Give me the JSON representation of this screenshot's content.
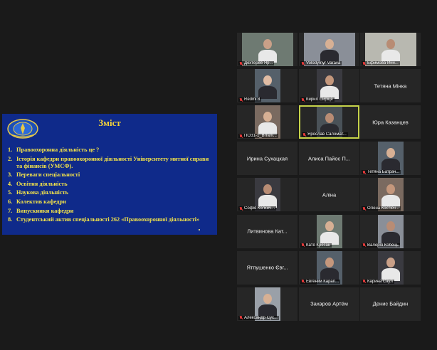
{
  "slide": {
    "title": "Зміст",
    "items": [
      {
        "num": "1.",
        "text": "Правоохоронна діяльність це ?"
      },
      {
        "num": "2.",
        "text": "Історія кафедри правоохоронної діяльності Університету митної справи та фінансів (УМСФ)."
      },
      {
        "num": "3.",
        "text": "Переваги спеціальності"
      },
      {
        "num": "4.",
        "text": "Освітня діяльність"
      },
      {
        "num": "5.",
        "text": "Наукова діяльність"
      },
      {
        "num": "6.",
        "text": "Колектив кафедри"
      },
      {
        "num": "7.",
        "text": "Випускники кафедри"
      },
      {
        "num": "8.",
        "text": "Студентський актив спеціальності 262 «Правоохоронної діяльності»"
      }
    ]
  },
  "participants": [
    {
      "name": "Дехтерев Яр...",
      "video": true,
      "muted": true
    },
    {
      "name": "Volodymyr Varava",
      "video": true,
      "muted": true
    },
    {
      "name": "Ефимова Инн...",
      "video": true,
      "muted": true
    },
    {
      "name": "Redmi 8",
      "video": true,
      "muted": true
    },
    {
      "name": "Кирил Сиріце",
      "video": true,
      "muted": true
    },
    {
      "name": "Тетяна Мінка",
      "video": false,
      "muted": false
    },
    {
      "name": "ПОЗ1-1_Віталі...",
      "video": true,
      "muted": true
    },
    {
      "name": "Ярослав Саломат...",
      "video": true,
      "muted": true,
      "active": true
    },
    {
      "name": "Юра Казанцев",
      "video": false,
      "muted": false
    },
    {
      "name": "Ирина Сухацкая",
      "video": false,
      "muted": false
    },
    {
      "name": "Алиса Пайос П...",
      "video": false,
      "muted": false
    },
    {
      "name": "Тетяна Батрач...",
      "video": true,
      "muted": true
    },
    {
      "name": "Софія Колкич...",
      "video": true,
      "muted": true
    },
    {
      "name": "Аліна",
      "video": false,
      "muted": false
    },
    {
      "name": "Олена Костюч...",
      "video": true,
      "muted": true
    },
    {
      "name": "Литвинова Кат...",
      "video": false,
      "muted": false
    },
    {
      "name": "Катя Кресан",
      "video": true,
      "muted": true
    },
    {
      "name": "Валерія Кобець",
      "video": true,
      "muted": true
    },
    {
      "name": "Ятпушенко Євг...",
      "video": false,
      "muted": false
    },
    {
      "name": "Евгений Карап...",
      "video": true,
      "muted": true
    },
    {
      "name": "Карина Саул",
      "video": true,
      "muted": true
    },
    {
      "name": "Александр Сус...",
      "video": true,
      "muted": true
    },
    {
      "name": "Захаров Артём",
      "video": false,
      "muted": false
    },
    {
      "name": "Денис Байдин",
      "video": false,
      "muted": false
    }
  ],
  "colors": {
    "slide_bg": "#0f2a8a",
    "slide_text": "#f2e24a",
    "active_speaker_border": "#c6d34a",
    "tile_bg": "#262626",
    "muted_icon": "#e23a3a"
  }
}
